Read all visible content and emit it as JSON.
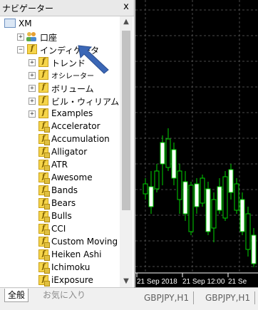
{
  "navigator": {
    "title": "ナビゲーター",
    "close_label": "x",
    "tree": [
      {
        "label": "XM",
        "indent": 0,
        "expander": "",
        "icon": "broker-icon"
      },
      {
        "label": "口座",
        "indent": 1,
        "expander": "+",
        "icon": "accounts-icon"
      },
      {
        "label": "インディケータ",
        "indent": 1,
        "expander": "−",
        "icon": "indicator-folder-icon"
      },
      {
        "label": "トレンド",
        "indent": 2,
        "expander": "+",
        "icon": "indicator-folder-icon"
      },
      {
        "label": "オシレーター",
        "indent": 2,
        "expander": "+",
        "icon": "indicator-folder-icon"
      },
      {
        "label": "ボリューム",
        "indent": 2,
        "expander": "+",
        "icon": "indicator-folder-icon"
      },
      {
        "label": "ビル・ウィリアムス",
        "indent": 2,
        "expander": "+",
        "icon": "indicator-folder-icon"
      },
      {
        "label": "Examples",
        "indent": 2,
        "expander": "+",
        "icon": "indicator-folder-icon"
      },
      {
        "label": "Accelerator",
        "indent": 2,
        "expander": "",
        "icon": "indicator-icon"
      },
      {
        "label": "Accumulation",
        "indent": 2,
        "expander": "",
        "icon": "indicator-icon"
      },
      {
        "label": "Alligator",
        "indent": 2,
        "expander": "",
        "icon": "indicator-icon"
      },
      {
        "label": "ATR",
        "indent": 2,
        "expander": "",
        "icon": "indicator-icon"
      },
      {
        "label": "Awesome",
        "indent": 2,
        "expander": "",
        "icon": "indicator-icon"
      },
      {
        "label": "Bands",
        "indent": 2,
        "expander": "",
        "icon": "indicator-icon"
      },
      {
        "label": "Bears",
        "indent": 2,
        "expander": "",
        "icon": "indicator-icon"
      },
      {
        "label": "Bulls",
        "indent": 2,
        "expander": "",
        "icon": "indicator-icon"
      },
      {
        "label": "CCI",
        "indent": 2,
        "expander": "",
        "icon": "indicator-icon"
      },
      {
        "label": "Custom Moving A",
        "indent": 2,
        "expander": "",
        "icon": "indicator-icon"
      },
      {
        "label": "Heiken Ashi",
        "indent": 2,
        "expander": "",
        "icon": "indicator-icon"
      },
      {
        "label": "Ichimoku",
        "indent": 2,
        "expander": "",
        "icon": "indicator-icon"
      },
      {
        "label": "iExposure",
        "indent": 2,
        "expander": "",
        "icon": "indicator-icon"
      }
    ],
    "tabs": {
      "all": "全般",
      "favorites": "お気に入り"
    }
  },
  "chart": {
    "time_labels": [
      "21 Sep 2018",
      "21 Sep 12:00",
      "21 Se"
    ],
    "tabs": [
      "GBPJPY,H1",
      "GBPJPY,H1"
    ],
    "colors": {
      "background": "#000000",
      "candle": "#00d400",
      "grid": "#4a4a4a",
      "annotation_arrow": "#3b67b6"
    }
  }
}
